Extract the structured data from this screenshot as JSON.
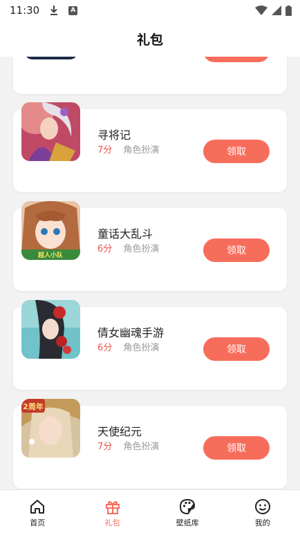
{
  "status_bar": {
    "time": "11:30",
    "download_icon": "download-icon",
    "badge_letter": "A"
  },
  "header": {
    "title": "礼包"
  },
  "claim_label": "领取",
  "games": [
    {
      "name": "寻将记",
      "score": "7分",
      "category": "角色扮演"
    },
    {
      "name": "童话大乱斗",
      "score": "6分",
      "category": "角色扮演"
    },
    {
      "name": "倩女幽魂手游",
      "score": "6分",
      "category": "角色扮演"
    },
    {
      "name": "天使纪元",
      "score": "7分",
      "category": "角色扮演"
    }
  ],
  "thumb_badges": {
    "tonghua": "超人小队",
    "tianshi": "2周年"
  },
  "tabs": [
    {
      "label": "首页",
      "icon": "home-icon"
    },
    {
      "label": "礼包",
      "icon": "gift-icon"
    },
    {
      "label": "壁纸库",
      "icon": "palette-icon"
    },
    {
      "label": "我的",
      "icon": "smiley-icon"
    }
  ],
  "colors": {
    "accent": "#f76d5c",
    "score": "#e8544a",
    "background": "#f2f2f2"
  }
}
